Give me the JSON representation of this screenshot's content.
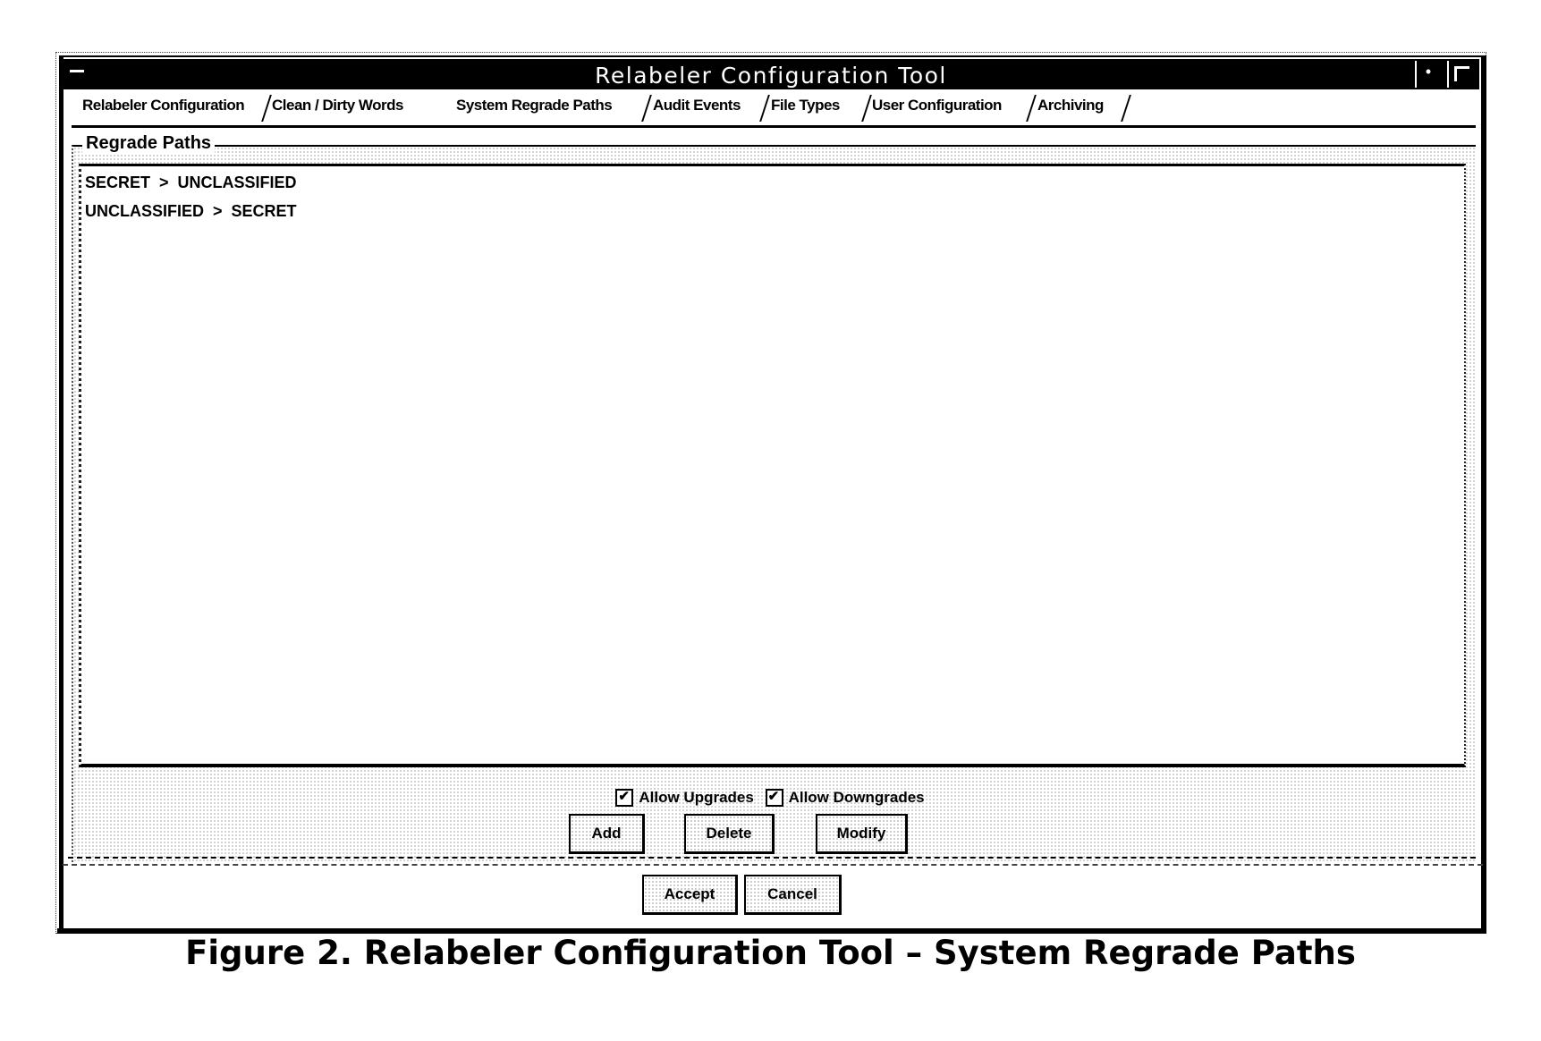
{
  "window": {
    "title": "Relabeler Configuration Tool",
    "system_menu_icon": "system-menu-icon",
    "minimize_icon": "minimize-icon",
    "maximize_icon": "maximize-icon",
    "minimize_glyph": "•"
  },
  "tabs": [
    {
      "label": "Relabeler Configuration",
      "active": false
    },
    {
      "label": "Clean / Dirty Words",
      "active": false
    },
    {
      "label": "System Regrade Paths",
      "active": true
    },
    {
      "label": "Audit Events",
      "active": false
    },
    {
      "label": "File Types",
      "active": false
    },
    {
      "label": "User Configuration",
      "active": false
    },
    {
      "label": "Archiving",
      "active": false
    }
  ],
  "group": {
    "label": "Regrade Paths",
    "items": [
      "SECRET  >  UNCLASSIFIED",
      "UNCLASSIFIED  >  SECRET"
    ]
  },
  "options": {
    "allow_upgrades": {
      "label": "Allow Upgrades",
      "checked": true
    },
    "allow_downgrades": {
      "label": "Allow Downgrades",
      "checked": true
    }
  },
  "buttons": {
    "add": "Add",
    "delete": "Delete",
    "modify": "Modify",
    "accept": "Accept",
    "cancel": "Cancel"
  },
  "caption": "Figure 2.  Relabeler Configuration Tool – System Regrade Paths"
}
